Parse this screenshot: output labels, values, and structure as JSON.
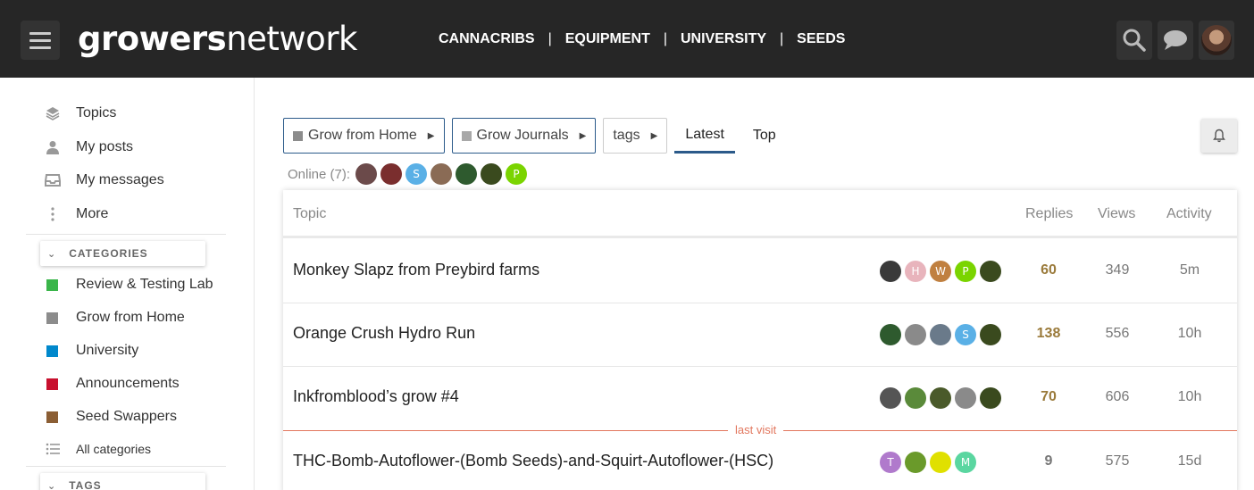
{
  "header": {
    "logo_bold": "growers",
    "logo_thin": "network",
    "nav": [
      "CANNACRIBS",
      "EQUIPMENT",
      "UNIVERSITY",
      "SEEDS"
    ],
    "nav_sep": "|"
  },
  "sidebar": {
    "items": [
      {
        "label": "Topics",
        "icon": "layers-icon"
      },
      {
        "label": "My posts",
        "icon": "user-icon"
      },
      {
        "label": "My messages",
        "icon": "inbox-icon"
      },
      {
        "label": "More",
        "icon": "more-vertical-icon"
      }
    ],
    "categories_header": "CATEGORIES",
    "categories": [
      {
        "label": "Review & Testing Lab",
        "color": "#3ab54a"
      },
      {
        "label": "Grow from Home",
        "color": "#8c8c8c"
      },
      {
        "label": "University",
        "color": "#0088cc"
      },
      {
        "label": "Announcements",
        "color": "#c8102e"
      },
      {
        "label": "Seed Swappers",
        "color": "#8b5e34"
      }
    ],
    "all_categories": "All categories",
    "tags_header": "TAGS"
  },
  "crumbs": [
    {
      "label": "Grow from Home"
    },
    {
      "label": "Grow Journals"
    },
    {
      "label": "tags"
    }
  ],
  "tabs": [
    {
      "label": "Latest",
      "active": true
    },
    {
      "label": "Top",
      "active": false
    }
  ],
  "online": {
    "label": "Online (7):",
    "users": [
      {
        "letter": "",
        "color": "#6b4a4a"
      },
      {
        "letter": "",
        "color": "#7a2e2e"
      },
      {
        "letter": "S",
        "color": "#5ab0e6"
      },
      {
        "letter": "",
        "color": "#8a6b55"
      },
      {
        "letter": "",
        "color": "#2e5a2e"
      },
      {
        "letter": "",
        "color": "#3a4a1e"
      },
      {
        "letter": "P",
        "color": "#7ad400"
      }
    ]
  },
  "table": {
    "headers": {
      "topic": "Topic",
      "replies": "Replies",
      "views": "Views",
      "activity": "Activity"
    },
    "rows": [
      {
        "title": "Monkey Slapz from Preybird farms",
        "replies": "60",
        "views": "349",
        "activity": "5m",
        "posters": [
          {
            "letter": "",
            "color": "#3a3a3a"
          },
          {
            "letter": "H",
            "color": "#e8b4bc"
          },
          {
            "letter": "W",
            "color": "#c08040"
          },
          {
            "letter": "P",
            "color": "#7ad400"
          },
          {
            "letter": "",
            "color": "#3a4a1e"
          }
        ]
      },
      {
        "title": "Orange Crush Hydro Run",
        "replies": "138",
        "views": "556",
        "activity": "10h",
        "posters": [
          {
            "letter": "",
            "color": "#2e5a2e"
          },
          {
            "letter": "",
            "color": "#8a8a8a"
          },
          {
            "letter": "",
            "color": "#6a7a8a"
          },
          {
            "letter": "S",
            "color": "#5ab0e6"
          },
          {
            "letter": "",
            "color": "#3a4a1e"
          }
        ]
      },
      {
        "title": "Inkfromblood’s grow #4",
        "replies": "70",
        "views": "606",
        "activity": "10h",
        "posters": [
          {
            "letter": "",
            "color": "#555555"
          },
          {
            "letter": "",
            "color": "#5a8a3a"
          },
          {
            "letter": "",
            "color": "#4a5a2a"
          },
          {
            "letter": "",
            "color": "#8a8a8a"
          },
          {
            "letter": "",
            "color": "#3a4a1e"
          }
        ]
      },
      {
        "title": "THC-Bomb-Autoflower-(Bomb Seeds)-and-Squirt-Autoflower-(HSC)",
        "replies": "9",
        "views": "575",
        "activity": "15d",
        "posters": [
          {
            "letter": "T",
            "color": "#b07acc"
          },
          {
            "letter": "",
            "color": "#6a9a2a"
          },
          {
            "letter": "",
            "color": "#e0e000"
          },
          {
            "letter": "M",
            "color": "#5ad6a0"
          }
        ]
      }
    ],
    "last_visit": "last visit"
  }
}
